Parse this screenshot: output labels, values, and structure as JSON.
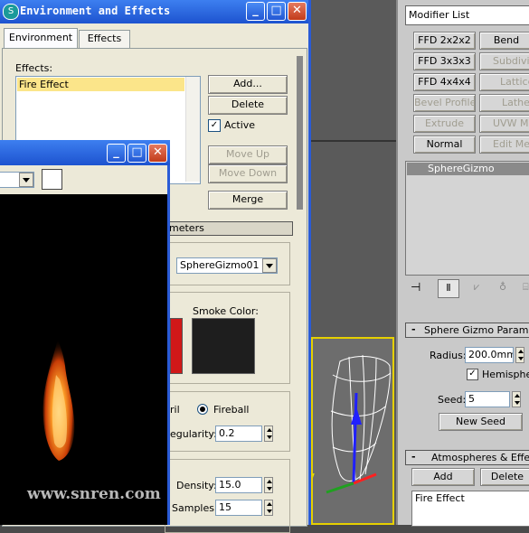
{
  "env_window": {
    "title": "Environment and Effects",
    "tabs": [
      "Environment",
      "Effects"
    ],
    "effects_label": "Effects:",
    "effects_list": [
      "Fire Effect"
    ],
    "buttons": {
      "add": "Add...",
      "delete": "Delete",
      "active": "Active",
      "move_up": "Move Up",
      "move_down": "Move Down",
      "merge": "Merge"
    },
    "params_rollout": "meters",
    "gizmo_field": "SphereGizmo01",
    "smoke_color_label": "Smoke Color:",
    "fireball_label": "Fireball",
    "tendril_partial": "ril",
    "irregularity_label": "egularity:",
    "irregularity_value": "0.2",
    "density_label": "Density:",
    "density_value": "15.0",
    "samples_label": "Samples:",
    "samples_value": "15"
  },
  "render_window": {
    "watermark": "www.snren.com"
  },
  "command_panel": {
    "modifier_list": "Modifier List",
    "modifier_buttons": [
      [
        "FFD 2x2x2",
        "Bend"
      ],
      [
        "FFD 3x3x3",
        "Subdivide"
      ],
      [
        "FFD 4x4x4",
        "Lattice"
      ],
      [
        "Bevel Profile",
        "Lathe"
      ],
      [
        "Extrude",
        "UVW Map"
      ],
      [
        "Normal",
        "Edit Mesh"
      ]
    ],
    "stack_item": "SphereGizmo",
    "gizmo_rollout": "Sphere Gizmo Parameters",
    "radius_label": "Radius:",
    "radius_value": "200.0mm",
    "hemisphere_label": "Hemisphere",
    "seed_label": "Seed:",
    "seed_value": "5",
    "new_seed": "New Seed",
    "atmos_rollout": "Atmospheres & Effects",
    "atmos_add": "Add",
    "atmos_delete": "Delete",
    "atmos_item": "Fire Effect"
  },
  "colors": {
    "xp_blue": "#2457d1",
    "fire": "#ff8a1c",
    "highlight": "#fbe58a"
  }
}
